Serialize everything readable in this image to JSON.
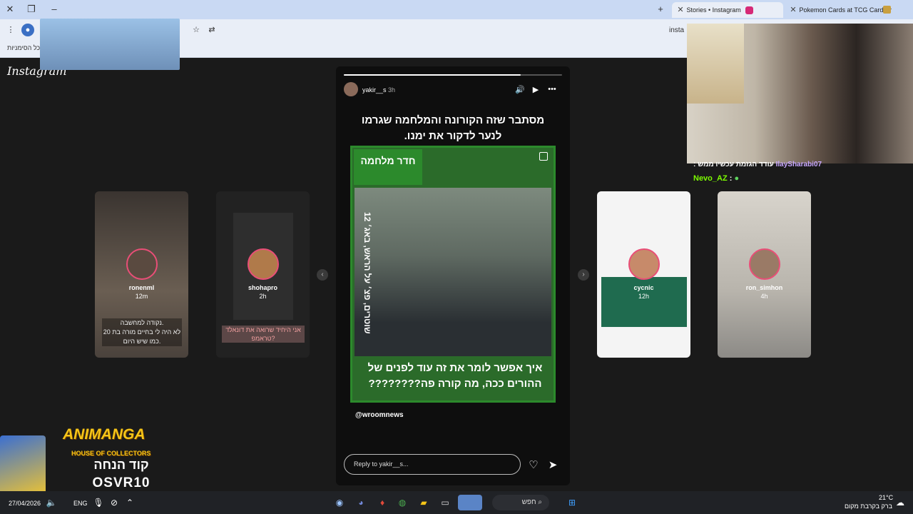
{
  "browser": {
    "tabs": [
      {
        "label": "Stories • Instagram",
        "active": true
      },
      {
        "label": "Pokemon Cards at TCG Card Sh",
        "active": false
      }
    ],
    "url": "insta",
    "bookmarks_label": "כל הסימניות"
  },
  "instagram": {
    "logo": "Instagram",
    "left_stories": [
      {
        "user": "ronenml",
        "time": "12m",
        "caption": "נקודה למחשבה.\nלא היה לי בחיים מורה בת 20\nכמו שיש היום."
      },
      {
        "user": "shohapro",
        "time": "2h",
        "caption": "אני היחיד שרואה את דונאלד\nטראמפ?"
      }
    ],
    "right_stories": [
      {
        "user": "cycnic",
        "time": "12h"
      },
      {
        "user": "ron_simhon",
        "time": "4h"
      }
    ],
    "story": {
      "user": "yakir__s",
      "time": "3h",
      "progress": 0.81,
      "headline": "מסתבר שזה הקורונה והמלחמה שגרמו לנער לדקור את ימנו.",
      "badge": "חדר מלחמה",
      "vertical_text": "12 שוטרים, פצ׳ על הראש, באג׳",
      "caption": "איך אפשר לומר את זה עוד לפנים של ההורים ככה, מה קורה פה????????",
      "credit": "@wroomnews",
      "reply_placeholder": "Reply to yakir__s..."
    }
  },
  "overlay": {
    "chat": [
      {
        "user": "IlaySharabi07",
        "text": "עודד הגזמת עכשיו ממש :"
      },
      {
        "user": "Nevo_AZ",
        "text": ":"
      }
    ],
    "promo": {
      "title": "ANIMANGA",
      "subtitle": "HOUSE OF COLLECTORS",
      "code_label": "קוד הנחה",
      "code": "OSVR10"
    }
  },
  "taskbar": {
    "date": "27/04/2026",
    "lang": "ENG",
    "search": "חפש",
    "temp": "21°C",
    "weather": "ברק בקרבת מקום"
  },
  "colors": {
    "accent_green": "#2c8a2c",
    "story_ring": "#e94e77"
  }
}
